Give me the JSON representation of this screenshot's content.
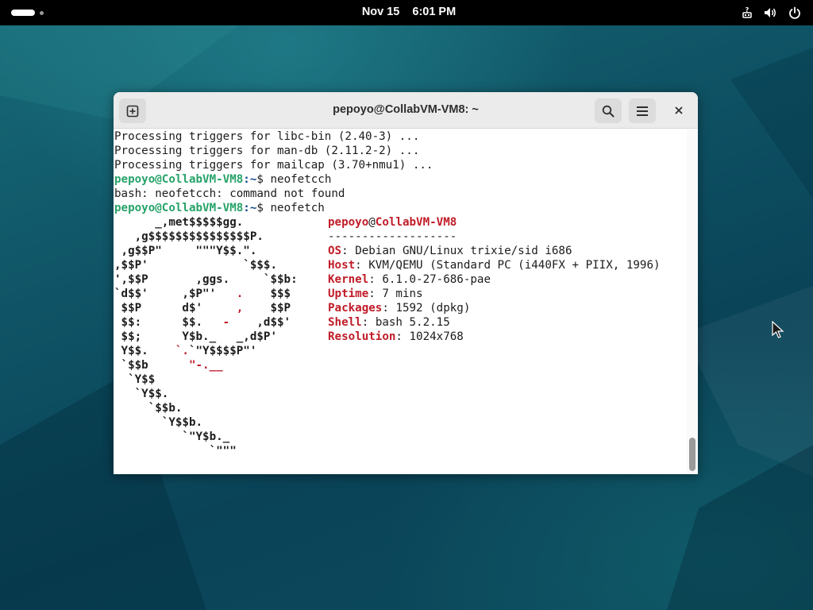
{
  "desktop": {
    "wallpaper_colors": [
      "#176a78",
      "#0a4358"
    ]
  },
  "topbar": {
    "date": "Nov 15",
    "time": "6:01 PM",
    "tray_icons": [
      "network-question-icon",
      "volume-icon",
      "power-icon"
    ]
  },
  "window": {
    "title": "pepoyo@CollabVM-VM8: ~",
    "buttons": [
      "new-tab-icon",
      "search-icon",
      "hamburger-menu-icon",
      "close-icon"
    ]
  },
  "terminal": {
    "lines": [
      "Processing triggers for libc-bin (2.40-3) ...",
      "Processing triggers for man-db (2.11.2-2) ...",
      "Processing triggers for mailcap (3.70+nmu1) ..."
    ],
    "prompt1": {
      "user": "pepoyo@CollabVM-VM8",
      "path": ":~",
      "symbol": "$ ",
      "command": "neofetcch"
    },
    "error": "bash: neofetcch: command not found",
    "prompt2": {
      "user": "pepoyo@CollabVM-VM8",
      "path": ":~",
      "symbol": "$ ",
      "command": "neofetch"
    }
  },
  "neofetch": {
    "logo": [
      [
        "      _,met$$$$$gg.",
        ""
      ],
      [
        "   ,g$$$$$$$$$$$$$$$P.",
        ""
      ],
      [
        " ,g$$P\"     \"\"\"Y$$.\".",
        ""
      ],
      [
        ",$$P'              `$$$.",
        ""
      ],
      [
        "',$$P       ,ggs.     `$$b:",
        ""
      ],
      [
        "`d$$'     ,$P\"'   ",
        ".",
        "    $$$"
      ],
      [
        " $$P      d$'     ",
        ",",
        "    $$P"
      ],
      [
        " $$:      $$.   ",
        "-",
        "    ,d$$'"
      ],
      [
        " $$;      Y$b._   _,d$P'",
        ""
      ],
      [
        " Y$$.    ",
        "`.",
        "`\"Y$$$$P\"'"
      ],
      [
        " `$$b      ",
        "\"-.__",
        ""
      ],
      [
        "  `Y$$",
        ""
      ],
      [
        "   `Y$$.",
        ""
      ],
      [
        "     `$$b.",
        ""
      ],
      [
        "       `Y$$b.",
        ""
      ],
      [
        "          `\"Y$b._",
        ""
      ],
      [
        "              `\"\"\"",
        ""
      ]
    ],
    "user": "pepoyo",
    "at": "@",
    "host": "CollabVM-VM8",
    "separator": "-------------------",
    "fields": [
      {
        "key": "OS",
        "value": "Debian GNU/Linux trixie/sid i686"
      },
      {
        "key": "Host",
        "value": "KVM/QEMU (Standard PC (i440FX + PIIX, 1996)"
      },
      {
        "key": "Kernel",
        "value": "6.1.0-27-686-pae"
      },
      {
        "key": "Uptime",
        "value": "7 mins"
      },
      {
        "key": "Packages",
        "value": "1592 (dpkg)"
      },
      {
        "key": "Shell",
        "value": "bash 5.2.15"
      },
      {
        "key": "Resolution",
        "value": "1024x768"
      }
    ],
    "key_suffix": ": "
  },
  "colors": {
    "prompt_user": "#26a269",
    "prompt_path": "#12488b",
    "accent_red": "#c01c28"
  },
  "scrollbar": {
    "position_fraction": 1.0
  }
}
